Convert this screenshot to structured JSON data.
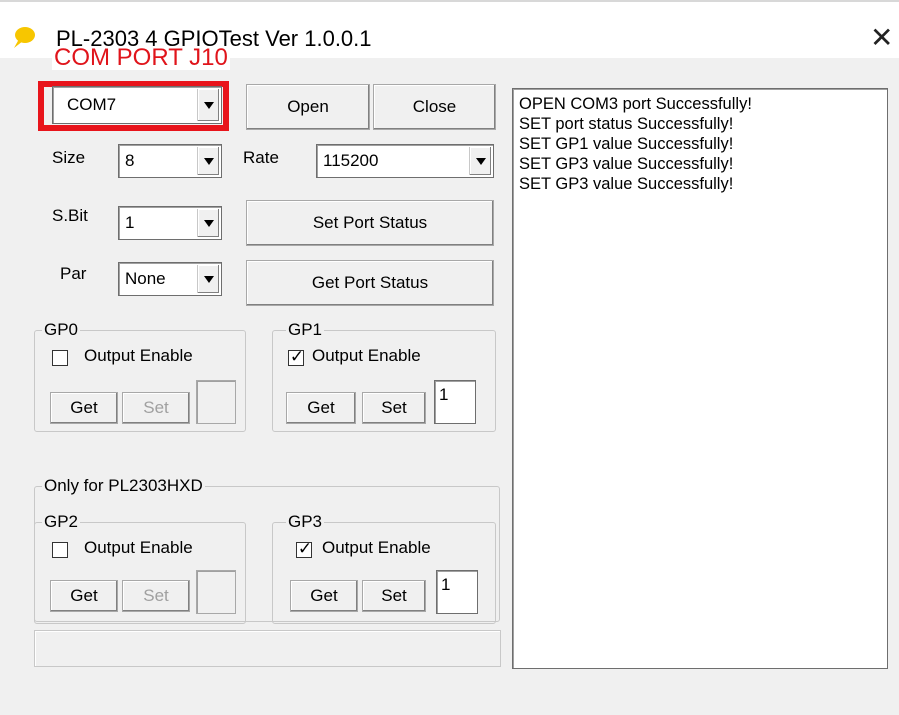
{
  "window": {
    "title": "PL-2303 4 GPIOTest Ver 1.0.0.1",
    "close_glyph": "✕"
  },
  "annotation": {
    "text": "COM PORT J10",
    "color": "#e0141b"
  },
  "port": {
    "com_value": "COM7",
    "open_label": "Open",
    "close_label": "Close",
    "size_label": "Size",
    "size_value": "8",
    "rate_label": "Rate",
    "rate_value": "115200",
    "sbit_label": "S.Bit",
    "sbit_value": "1",
    "par_label": "Par",
    "par_value": "None",
    "set_status_label": "Set Port Status",
    "get_status_label": "Get Port Status"
  },
  "gp0": {
    "title": "GP0",
    "checkbox_label": "Output Enable",
    "checked": false,
    "get_label": "Get",
    "set_label": "Set",
    "value": ""
  },
  "gp1": {
    "title": "GP1",
    "checkbox_label": "Output Enable",
    "checked": true,
    "get_label": "Get",
    "set_label": "Set",
    "value": "1"
  },
  "hxd_group": {
    "title": "Only for PL2303HXD"
  },
  "gp2": {
    "title": "GP2",
    "checkbox_label": "Output Enable",
    "checked": false,
    "get_label": "Get",
    "set_label": "Set",
    "value": ""
  },
  "gp3": {
    "title": "GP3",
    "checkbox_label": "Output Enable",
    "checked": true,
    "get_label": "Get",
    "set_label": "Set",
    "value": "1"
  },
  "checkmark": "✓",
  "log": [
    "OPEN COM3 port Successfully!",
    "SET port status Successfully!",
    "SET GP1 value Successfully!",
    "SET GP3 value Successfully!",
    "SET GP3 value Successfully!"
  ]
}
